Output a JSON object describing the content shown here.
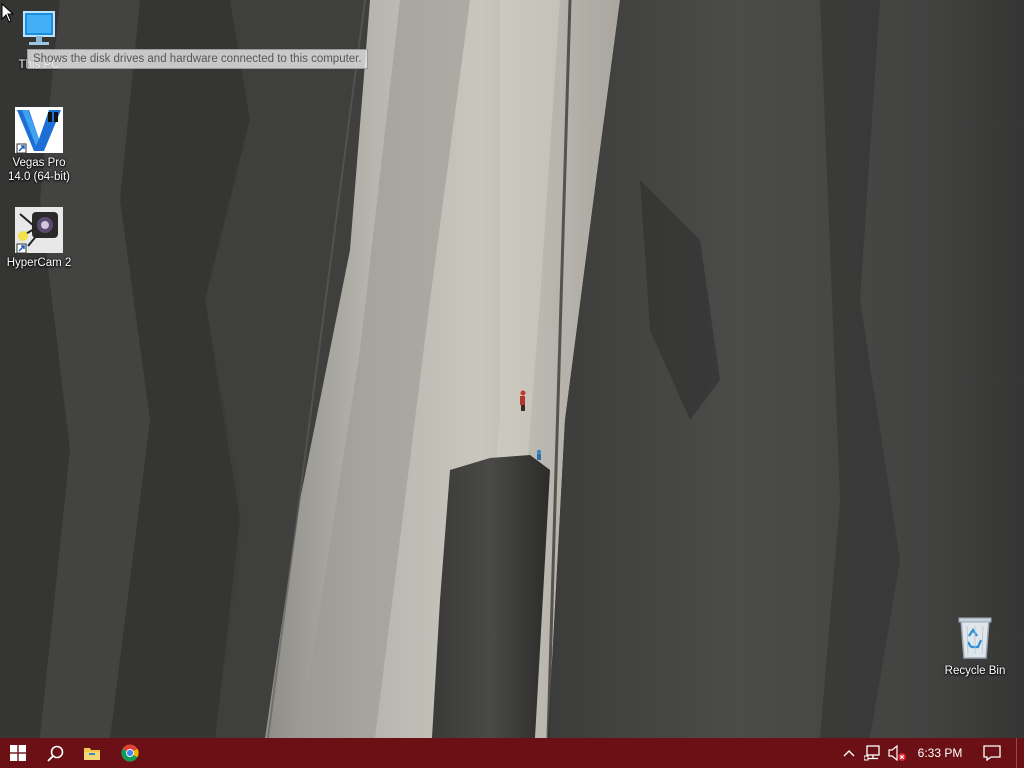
{
  "desktop": {
    "icons": [
      {
        "id": "this-pc",
        "label": "This PC",
        "icon": "computer-monitor-icon"
      },
      {
        "id": "vegas",
        "label": "Vegas Pro 14.0 (64-bit)",
        "icon": "vegas-pro-icon",
        "shortcut": true
      },
      {
        "id": "hypercam",
        "label": "HyperCam 2",
        "icon": "hypercam-icon",
        "shortcut": true
      },
      {
        "id": "recycle",
        "label": "Recycle Bin",
        "icon": "recycle-bin-icon"
      }
    ],
    "tooltip": "Shows the disk drives and hardware connected to this computer.",
    "wallpaper": "granite-cliff-with-climbers"
  },
  "taskbar": {
    "color": "#6b1115",
    "pinned": [
      {
        "id": "start",
        "icon": "windows-logo-icon"
      },
      {
        "id": "search",
        "icon": "search-icon"
      },
      {
        "id": "explorer",
        "icon": "folder-icon"
      },
      {
        "id": "chrome",
        "icon": "chrome-icon"
      }
    ],
    "tray": {
      "chevron_icon": "chevron-up-icon",
      "network_icon": "network-icon",
      "volume_icon": "volume-muted-icon",
      "clock": "6:33 PM",
      "action_center_icon": "action-center-icon"
    }
  }
}
